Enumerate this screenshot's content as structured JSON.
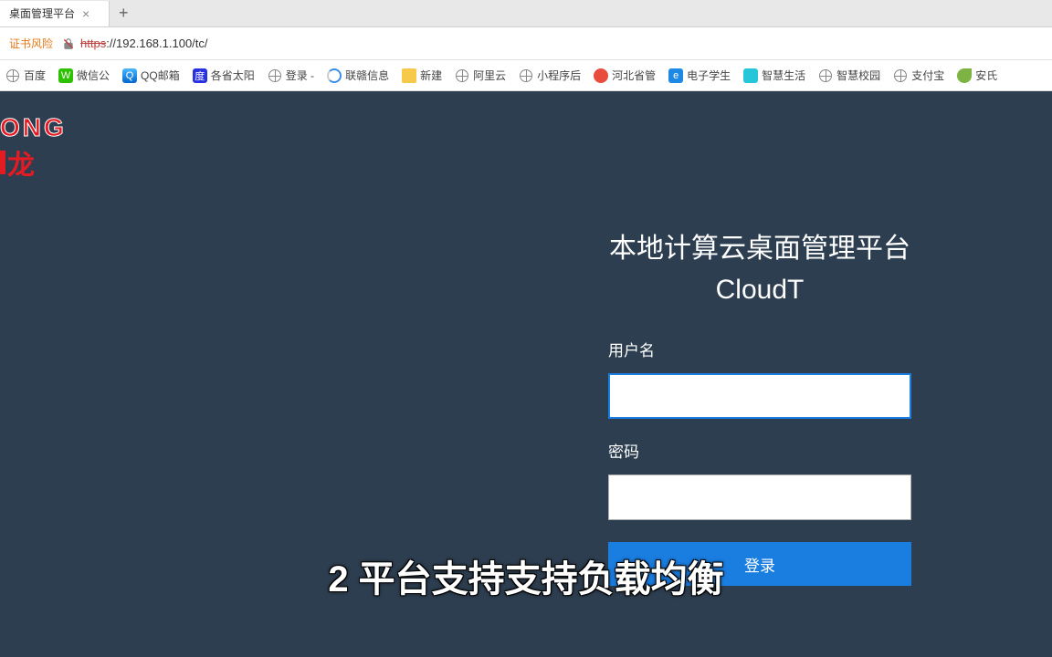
{
  "browser": {
    "tab_title": "桌面管理平台",
    "cert_warning": "证书风险",
    "url_scheme": "https",
    "url_rest": "://192.168.1.100/tc/",
    "bookmarks": [
      {
        "label": "百度",
        "icon": "globe"
      },
      {
        "label": "微信公",
        "icon": "wechat"
      },
      {
        "label": "QQ邮箱",
        "icon": "qq"
      },
      {
        "label": "各省太阳",
        "icon": "baidu"
      },
      {
        "label": "登录 -",
        "icon": "globe"
      },
      {
        "label": "联赣信息",
        "icon": "circle"
      },
      {
        "label": "新建",
        "icon": "folder"
      },
      {
        "label": "阿里云",
        "icon": "globe"
      },
      {
        "label": "小程序后",
        "icon": "globe"
      },
      {
        "label": "河北省管",
        "icon": "red"
      },
      {
        "label": "电子学生",
        "icon": "blue"
      },
      {
        "label": "智慧生活",
        "icon": "teal"
      },
      {
        "label": "智慧校园",
        "icon": "globe"
      },
      {
        "label": "支付宝",
        "icon": "globe"
      },
      {
        "label": "安氏",
        "icon": "green"
      }
    ]
  },
  "logo": {
    "top": "ONG",
    "bottom": "龙"
  },
  "login": {
    "title_line1": "本地计算云桌面管理平台",
    "title_line2": "CloudT",
    "username_label": "用户名",
    "password_label": "密码",
    "submit_label": "登录"
  },
  "caption": "2 平台支持支持负载均衡"
}
